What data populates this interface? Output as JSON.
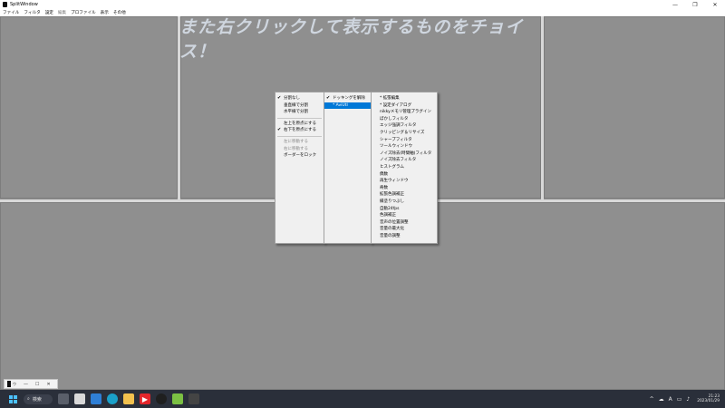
{
  "window": {
    "title": "SplitWindow",
    "minimize": "—",
    "maximize": "❐",
    "close": "✕"
  },
  "menubar": {
    "items": [
      "ファイル",
      "フィルタ",
      "設定",
      "編集",
      "プロファイル",
      "表示",
      "その他"
    ]
  },
  "banner": {
    "text": "また右クリックして表示するものをチョイス！"
  },
  "context_menu": {
    "col1": {
      "items": [
        {
          "label": "分割なし",
          "checked": true,
          "disabled": false
        },
        {
          "label": "垂直線で分割",
          "checked": false,
          "disabled": false
        },
        {
          "label": "水平線で分割",
          "checked": false,
          "disabled": false
        },
        {
          "label": "左上を原点にする",
          "checked": false,
          "disabled": false
        },
        {
          "label": "右下を原点にする",
          "checked": true,
          "disabled": false
        },
        {
          "label": "左に移動する",
          "checked": false,
          "disabled": true
        },
        {
          "label": "右に移動する",
          "checked": false,
          "disabled": true
        },
        {
          "label": "ボーダーをロック",
          "checked": false,
          "disabled": false
        }
      ]
    },
    "col2": {
      "items": [
        {
          "label": "ドッキングを解除",
          "checked": true,
          "selected": false
        },
        {
          "label": "* AviUtl",
          "checked": false,
          "selected": true
        }
      ]
    },
    "col3": {
      "items": [
        "* 拡張編集",
        "* 設定ダイアログ",
        "nikkyメモリ管理プラグイン",
        "ぼかしフィルタ",
        "エッジ強調フィルタ",
        "クリッピング＆リサイズ",
        "シャープフィルタ",
        "ツールウィンドウ",
        "ノイズ除去(時間軸)フィルタ",
        "ノイズ除去フィルタ",
        "ヒストグラム",
        "偶数",
        "再生ウィンドウ",
        "奇数",
        "拡張色調補正",
        "縁塗りつぶし",
        "自動24fps",
        "色調補正",
        "音声の位置調整",
        "音量の最大化",
        "音量の調整"
      ]
    }
  },
  "taskbar": {
    "search_label": "検索",
    "time": "21:23",
    "date": "2023/01/29",
    "ime": "A"
  },
  "preview": {
    "label": "ウ"
  },
  "colors": {
    "workspace": "#909090",
    "splitter": "#d8d8d8",
    "taskbar": "#2a2f3a",
    "menu_highlight": "#0078d7",
    "banner": "#cfd6df"
  }
}
